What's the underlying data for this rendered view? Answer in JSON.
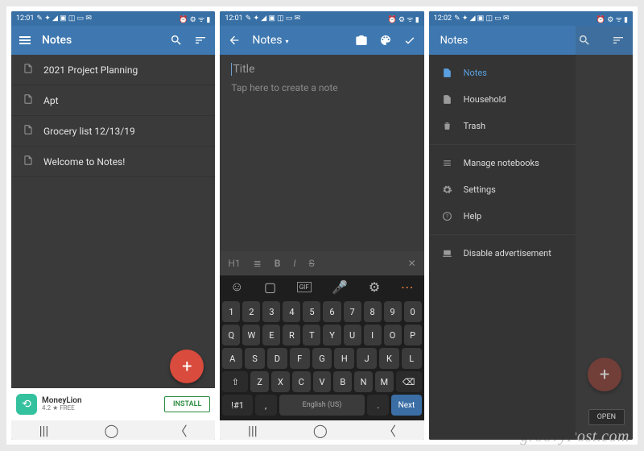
{
  "watermark": "groovyPost.com",
  "status": {
    "time1": "12:01",
    "time2": "12:01",
    "time3": "12:02",
    "icons_left": "✎ ✦ ◢ ▣ ◫ ▭ ✉",
    "icons_right": "⏰ ⚙ ᯤ ▮"
  },
  "screen1": {
    "title": "Notes",
    "notes": [
      "2021 Project Planning",
      "Apt",
      "Grocery list 12/13/19",
      "Welcome to Notes!"
    ],
    "ad": {
      "name": "MoneyLion",
      "rating": "4.2 ★  FREE",
      "cta": "INSTALL"
    }
  },
  "screen2": {
    "breadcrumb": "Notes",
    "title_placeholder": "Title",
    "body_placeholder": "Tap here to create a note",
    "format": {
      "h1": "H1",
      "bold": "B",
      "italic": "I",
      "strike": "S"
    },
    "keyboard": {
      "row_num": [
        "1",
        "2",
        "3",
        "4",
        "5",
        "6",
        "7",
        "8",
        "9",
        "0"
      ],
      "row_q": [
        "Q",
        "W",
        "E",
        "R",
        "T",
        "Y",
        "U",
        "I",
        "O",
        "P"
      ],
      "row_a": [
        "A",
        "S",
        "D",
        "F",
        "G",
        "H",
        "J",
        "K",
        "L"
      ],
      "row_z": [
        "Z",
        "X",
        "C",
        "V",
        "B",
        "N",
        "M"
      ],
      "shift": "⇧",
      "back": "⌫",
      "sym": "!#1",
      "comma": ",",
      "space": "English (US)",
      "dot": ".",
      "next": "Next"
    }
  },
  "screen3": {
    "title": "Notes",
    "sections": {
      "notebooks": [
        {
          "label": "Notes",
          "active": true,
          "icon": "note"
        },
        {
          "label": "Household",
          "active": false,
          "icon": "note"
        },
        {
          "label": "Trash",
          "active": false,
          "icon": "trash"
        }
      ],
      "manage": [
        {
          "label": "Manage notebooks",
          "icon": "list"
        },
        {
          "label": "Settings",
          "icon": "gear"
        },
        {
          "label": "Help",
          "icon": "help"
        }
      ],
      "misc": [
        {
          "label": "Disable advertisement",
          "icon": "screen"
        }
      ]
    },
    "open": "OPEN"
  }
}
